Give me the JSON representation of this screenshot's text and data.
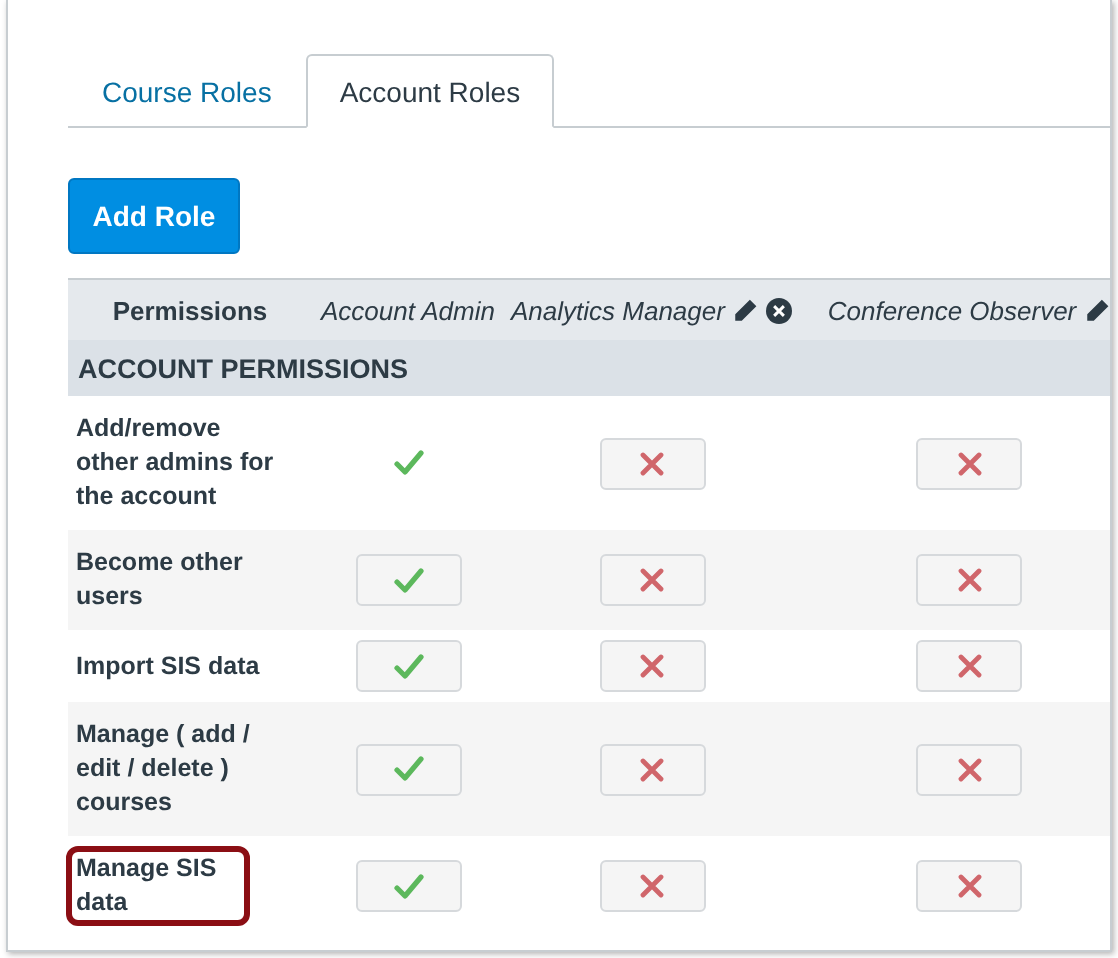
{
  "tabs": [
    {
      "label": "Course Roles",
      "selected": false
    },
    {
      "label": "Account Roles",
      "selected": true
    }
  ],
  "add_button": "Add Role",
  "table": {
    "corner": "Permissions",
    "columns": [
      {
        "label": "Account Admin",
        "editable": false,
        "removable": false
      },
      {
        "label": "Analytics Manager",
        "editable": true,
        "removable": true
      },
      {
        "label": "Conference Observer",
        "editable": true,
        "removable": false
      }
    ],
    "section": "ACCOUNT PERMISSIONS",
    "rows": [
      {
        "label": "Add/remove other admins for the account",
        "highlighted": false,
        "cells": [
          {
            "kind": "locked",
            "enabled": true
          },
          {
            "kind": "toggle",
            "enabled": false
          },
          {
            "kind": "toggle",
            "enabled": false
          }
        ]
      },
      {
        "label": "Become other users",
        "highlighted": false,
        "cells": [
          {
            "kind": "toggle",
            "enabled": true
          },
          {
            "kind": "toggle",
            "enabled": false
          },
          {
            "kind": "toggle",
            "enabled": false
          }
        ]
      },
      {
        "label": "Import SIS data",
        "highlighted": false,
        "cells": [
          {
            "kind": "toggle",
            "enabled": true
          },
          {
            "kind": "toggle",
            "enabled": false
          },
          {
            "kind": "toggle",
            "enabled": false
          }
        ]
      },
      {
        "label": "Manage ( add / edit / delete ) courses",
        "highlighted": false,
        "cells": [
          {
            "kind": "toggle",
            "enabled": true
          },
          {
            "kind": "toggle",
            "enabled": false
          },
          {
            "kind": "toggle",
            "enabled": false
          }
        ]
      },
      {
        "label": "Manage SIS data",
        "highlighted": true,
        "cells": [
          {
            "kind": "toggle",
            "enabled": true
          },
          {
            "kind": "toggle",
            "enabled": false
          },
          {
            "kind": "toggle",
            "enabled": false
          }
        ]
      }
    ]
  }
}
